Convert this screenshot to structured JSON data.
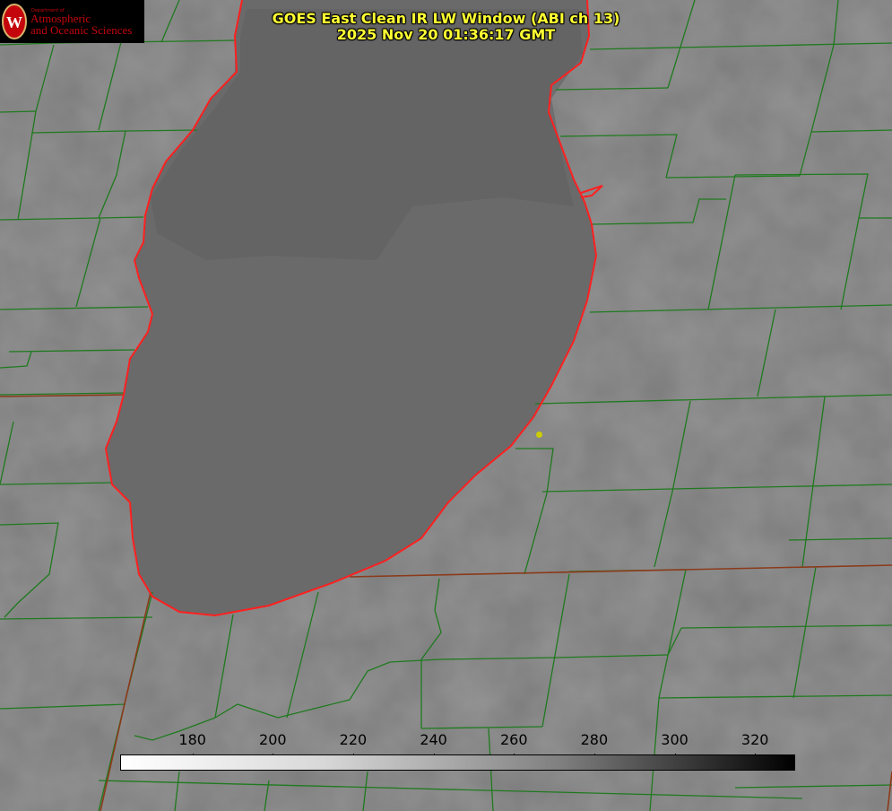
{
  "header": {
    "title": "GOES East Clean IR LW Window (ABI ch 13)",
    "timestamp": "2025 Nov 20 01:36:17 GMT"
  },
  "logo": {
    "department": "Department of",
    "line1": "Atmospheric",
    "line2": "and Oceanic Sciences",
    "seal_letter": "W"
  },
  "colorbar": {
    "ticks": [
      "180",
      "200",
      "220",
      "240",
      "260",
      "280",
      "300",
      "320"
    ],
    "tick_values": [
      180,
      200,
      220,
      240,
      260,
      280,
      300,
      320
    ],
    "range": [
      162,
      330
    ]
  },
  "colors": {
    "county_lines": "#1f7a1f",
    "state_lines": "#8b3a1a",
    "shoreline": "#ff2020",
    "title_text": "#ffff33",
    "station_marker": "#cccc00",
    "brand": "#c5050c"
  }
}
